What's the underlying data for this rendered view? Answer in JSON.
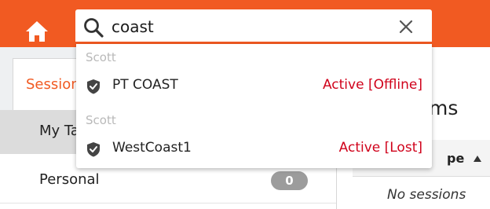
{
  "search": {
    "value": "coast",
    "icon": "search-icon",
    "clear_icon": "close-icon"
  },
  "nav": {
    "home_icon": "home-icon"
  },
  "tabs": {
    "sessions_label": "Sessions"
  },
  "list": {
    "items": [
      {
        "label": "My Tasks"
      },
      {
        "label": "Personal",
        "count": "0"
      }
    ]
  },
  "right": {
    "title": "ms",
    "column_header": "pe",
    "sort_icon": "sort-up-icon",
    "empty_text": "No sessions"
  },
  "dropdown": {
    "groups": [
      {
        "label": "Scott",
        "result": {
          "name": "PT COAST",
          "status": "Active [Offline]",
          "icon": "shield-icon"
        }
      },
      {
        "label": "Scott",
        "result": {
          "name": "WestCoast1",
          "status": "Active [Lost]",
          "icon": "shield-icon"
        }
      }
    ]
  },
  "colors": {
    "brand": "#f15a22",
    "status": "#d0021b",
    "badge": "#9c9c9c"
  }
}
